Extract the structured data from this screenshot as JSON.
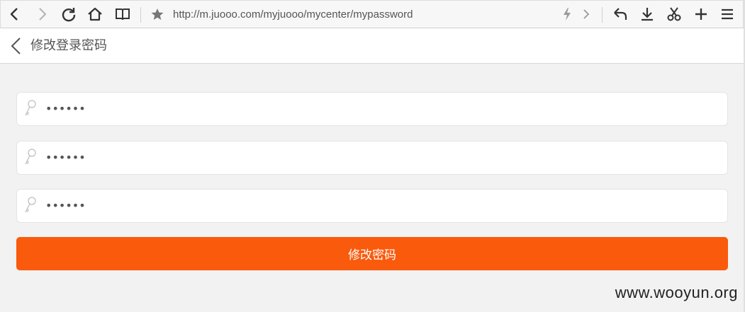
{
  "browser": {
    "url": "http://m.juooo.com/myjuooo/mycenter/mypassword",
    "buttons": [
      "back",
      "forward",
      "reload",
      "home",
      "reader",
      "bookmark",
      "fast",
      "more",
      "undo",
      "download",
      "scissors",
      "new-tab",
      "menu"
    ]
  },
  "header": {
    "title": "修改登录密码"
  },
  "form": {
    "fields": [
      {
        "value": "••••••"
      },
      {
        "value": "••••••"
      },
      {
        "value": "••••••"
      }
    ],
    "submit_label": "修改密码"
  },
  "colors": {
    "accent": "#fa5a0c",
    "background": "#f2f2f2"
  },
  "watermark": "www.wooyun.org"
}
